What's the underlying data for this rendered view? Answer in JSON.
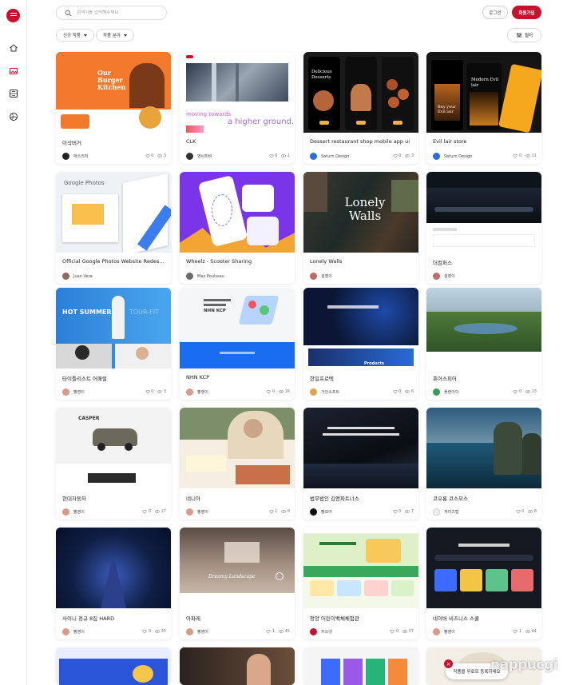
{
  "header": {
    "search_placeholder": "검색어를 입력해주세요",
    "login_label": "로그인",
    "join_label": "회원가입"
  },
  "filters": {
    "chip1": "신규 작품",
    "chip2": "작품 분야",
    "filter_label": "필터"
  },
  "rail": {
    "icons": [
      "menu-icon",
      "home-icon",
      "image-icon",
      "gallery-icon",
      "globe-icon"
    ]
  },
  "cards": [
    {
      "title": "이삭버거",
      "author": "애스리자",
      "likes": "0",
      "views": "3"
    },
    {
      "title": "CLK",
      "author": "엔씨피비",
      "likes": "0",
      "views": "1"
    },
    {
      "title": "Dessert restaurant shop mobile app ui",
      "author": "Saturn Design",
      "likes": "0",
      "views": "3"
    },
    {
      "title": "Evil lair store",
      "author": "Saturn Design",
      "likes": "0",
      "views": "11"
    },
    {
      "title": "Official Google Photos Website Redesign",
      "author": "Juan Vera",
      "likes": "",
      "views": ""
    },
    {
      "title": "Wheelz - Scooter Sharing",
      "author": "Max Poulssau",
      "likes": "",
      "views": ""
    },
    {
      "title": "Lonely Walls",
      "author": "설영이",
      "likes": "",
      "views": ""
    },
    {
      "title": "더컴퍼스",
      "author": "설영이",
      "likes": "",
      "views": ""
    },
    {
      "title": "타이틀리스트 어패럴",
      "author": "빵영이",
      "likes": "0",
      "views": "3"
    },
    {
      "title": "NHN KCP",
      "author": "빵영이",
      "likes": "0",
      "views": "16"
    },
    {
      "title": "한일프로텍",
      "author": "거인소프트",
      "likes": "0",
      "views": "6"
    },
    {
      "title": "퓨어스피어",
      "author": "플랜아이",
      "likes": "0",
      "views": "13"
    },
    {
      "title": "현대자동차",
      "author": "빵영이",
      "likes": "0",
      "views": "17"
    },
    {
      "title": "네니아",
      "author": "빵영이",
      "likes": "1",
      "views": "8"
    },
    {
      "title": "법무법인 김앤파트너스",
      "author": "빵모어",
      "likes": "0",
      "views": "7"
    },
    {
      "title": "코오롱 코스모스",
      "author": "게이츠랩",
      "likes": "0",
      "views": "8"
    },
    {
      "title": "사이니 정규 8집 HARD",
      "author": "빵영이",
      "likes": "0",
      "views": "35"
    },
    {
      "title": "아파레",
      "author": "빵영이",
      "likes": "1",
      "views": "45"
    },
    {
      "title": "청양 어린이백체체험관",
      "author": "지오넷",
      "likes": "0",
      "views": "37"
    },
    {
      "title": "네이버 비즈니스 스쿨",
      "author": "빵영이",
      "likes": "1",
      "views": "44"
    }
  ],
  "thumb_text": {
    "burger": "Our Burger Kitchen",
    "clk_1": "moving towards",
    "clk_2": "a higher ground.",
    "dessert": "Delicious Desserts",
    "evil_1": "Modern Evil lair",
    "evil_2": "Buy your Evil lair",
    "google": "Google Photos",
    "lonely": "Lonely Walls",
    "summer": "HOT SUMMER",
    "summer_2": "TOUR-FIT",
    "casper": "CASPER",
    "dreamy": "Dreamy Landscape",
    "nhn": "NHN KCP",
    "products": "Products"
  },
  "promo": {
    "label": "작품을 무료로 등록하세요",
    "close": "×",
    "watermark": "nappucgi"
  },
  "colors": {
    "brand": "#c8102e"
  }
}
